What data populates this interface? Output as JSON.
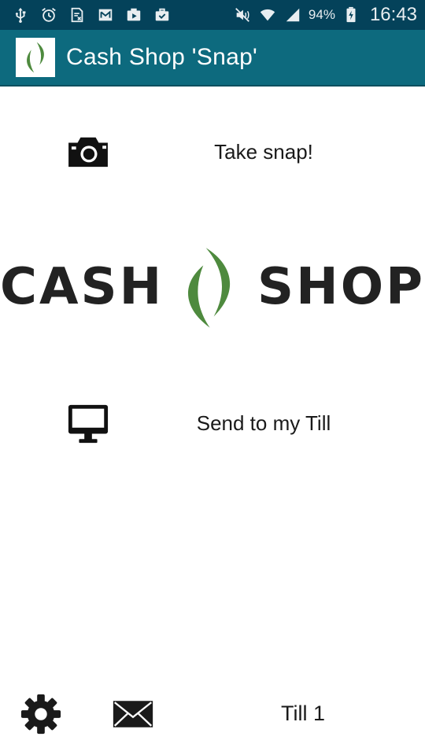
{
  "status_bar": {
    "left_icons": [
      "usb-icon",
      "alarm-icon",
      "sim-card-icon",
      "mail-notification-icon",
      "media-upload-icon",
      "briefcase-check-icon"
    ],
    "right_icons": [
      "mute-icon",
      "wifi-icon",
      "signal-icon",
      "battery-charging-icon"
    ],
    "battery": "94%",
    "time": "16:43"
  },
  "app_bar": {
    "title": "Cash Shop 'Snap'",
    "logo_icon": "cash-shop-leaf-logo"
  },
  "actions": {
    "snap": {
      "label": "Take snap!",
      "icon": "camera-icon"
    },
    "send": {
      "label": "Send to my Till",
      "icon": "monitor-icon"
    }
  },
  "brand": {
    "left_word": "CASH",
    "right_word": "SHOP",
    "mark_color": "#4e8a3e"
  },
  "bottom_bar": {
    "settings_icon": "gear-icon",
    "mail_icon": "envelope-icon",
    "till": "Till 1"
  },
  "colors": {
    "status_bar": "#04425a",
    "app_bar": "#0d6a7e",
    "accent_green": "#4e8a3e"
  }
}
